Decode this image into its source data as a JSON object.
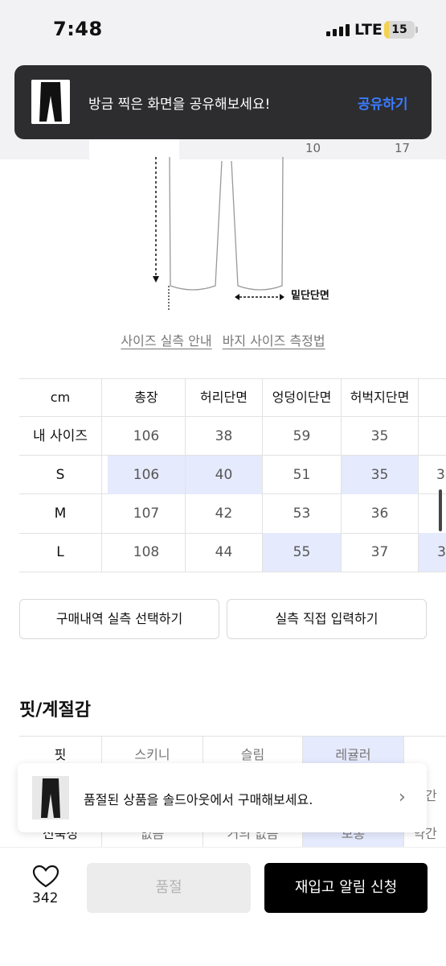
{
  "status_bar": {
    "time": "7:48",
    "network": "LTE",
    "battery": "15",
    "battery_level_percent": 15
  },
  "toast_share": {
    "message": "방금 찍은 화면을 공유해보세요!",
    "action": "공유하기"
  },
  "tabs": {
    "numbers": [
      "10",
      "17"
    ]
  },
  "diagram": {
    "hem_label": "밑단단면"
  },
  "guide_links": [
    "사이즈 실측 안내",
    "바지 사이즈 측정법"
  ],
  "size_table": {
    "headers": [
      "cm",
      "총장",
      "허리단면",
      "엉덩이단면",
      "허벅지단면"
    ],
    "rows": [
      {
        "label": "내 사이즈",
        "values": [
          "106",
          "38",
          "59",
          "35"
        ]
      },
      {
        "label": "S",
        "values": [
          "106",
          "40",
          "51",
          "35"
        ]
      },
      {
        "label": "M",
        "values": [
          "107",
          "42",
          "53",
          "36"
        ]
      },
      {
        "label": "L",
        "values": [
          "108",
          "44",
          "55",
          "37"
        ]
      }
    ],
    "partial_column_values": [
      "3",
      "3"
    ]
  },
  "buttons": {
    "purchase_history": "구매내역 실측 선택하기",
    "direct_input": "실측 직접 입력하기"
  },
  "fit_section": {
    "title": "핏/계절감",
    "rows": [
      {
        "label": "핏",
        "values": [
          "스키니",
          "슬림",
          "레귤러"
        ]
      },
      {
        "label": "신축성",
        "values": [
          "없음",
          "거의 없음",
          "보통",
          "약간"
        ]
      }
    ],
    "partial_values": [
      "약간"
    ]
  },
  "toast_soldout": {
    "message": "품절된 상품을 솔드아웃에서 구매해보세요."
  },
  "bottom_bar": {
    "like_count": "342",
    "soldout_label": "품절",
    "restock_label": "재입고 알림 신청"
  },
  "colors": {
    "highlight": "#e6eafd",
    "toast_dark": "#2d2d2f",
    "link_blue": "#3a7bff"
  }
}
